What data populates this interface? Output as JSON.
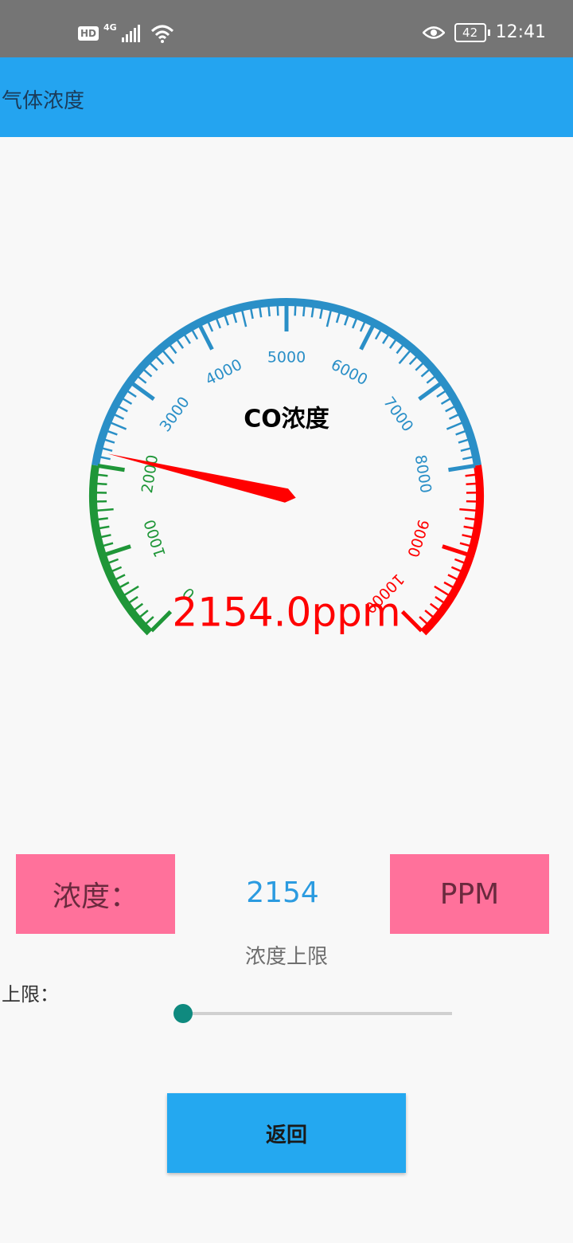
{
  "status_bar": {
    "hd_badge": "HD",
    "network": "4G",
    "battery": "42",
    "time": "12:41",
    "icons": [
      "signal-icon",
      "wifi-icon",
      "eye-icon",
      "battery-icon"
    ]
  },
  "app_bar": {
    "title": "气体浓度",
    "color": "#24a4f0"
  },
  "gauge": {
    "title": "CO浓度",
    "value": 2154.0,
    "value_text": "2154.0ppm",
    "min": 0,
    "max": 10000,
    "tick_labels": [
      "0",
      "1000",
      "2000",
      "3000",
      "4000",
      "5000",
      "6000",
      "7000",
      "8000",
      "9000",
      "10000"
    ],
    "zones": [
      {
        "from": 0,
        "to": 2000,
        "color": "#1f9638"
      },
      {
        "from": 2000,
        "to": 8000,
        "color": "#2a8fc7"
      },
      {
        "from": 8000,
        "to": 10000,
        "color": "#ff0000"
      }
    ],
    "needle_color": "#ff0000",
    "value_color": "#ff0000"
  },
  "concentration": {
    "label": "浓度：",
    "value": "2154",
    "unit": "PPM",
    "box_color": "#ff719b"
  },
  "upper_limit": {
    "title": "浓度上限",
    "label": "上限：",
    "slider_level": 0
  },
  "back_button": {
    "label": "返回"
  }
}
